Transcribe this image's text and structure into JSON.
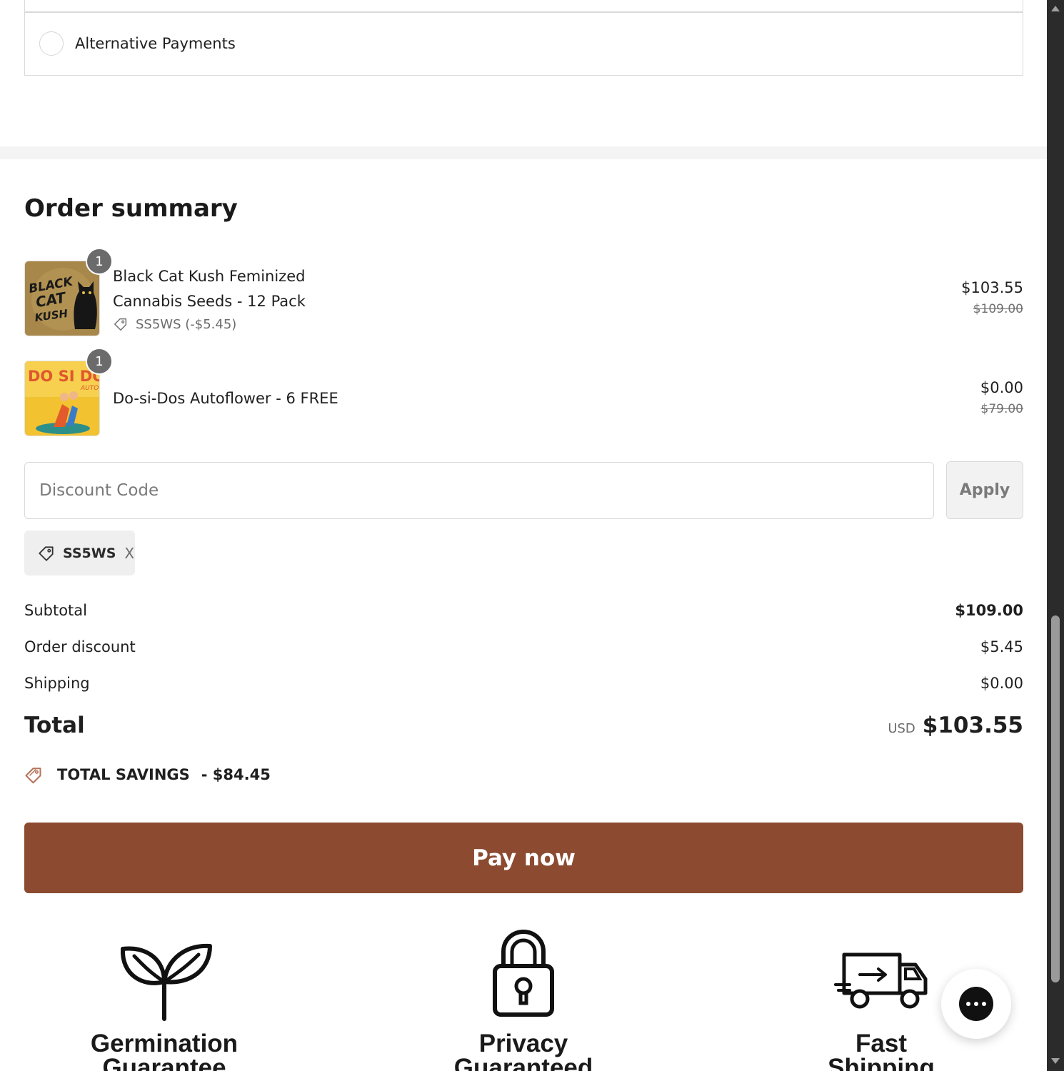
{
  "payment": {
    "option_label": "Alternative Payments"
  },
  "summary": {
    "title": "Order summary",
    "items": [
      {
        "quantity": "1",
        "name_line1": "Black Cat Kush Feminized",
        "name_line2": "Cannabis Seeds - 12 Pack",
        "discount": "SS5WS (-$5.45)",
        "price": "$103.55",
        "original_price": "$109.00",
        "image_text": [
          "BLACK",
          "CAT",
          "KUSH"
        ]
      },
      {
        "quantity": "1",
        "name": "Do-si-Dos Autoflower - 6 FREE",
        "price": "$0.00",
        "original_price": "$79.00",
        "image_text": [
          "DO SI DOS",
          "AUTO"
        ]
      }
    ],
    "discount_placeholder": "Discount Code",
    "apply_label": "Apply",
    "applied_code": "SS5WS",
    "remove_code": "X",
    "subtotal_label": "Subtotal",
    "subtotal_value": "$109.00",
    "order_discount_label": "Order discount",
    "order_discount_value": "$5.45",
    "shipping_label": "Shipping",
    "shipping_value": "$0.00",
    "total_label": "Total",
    "currency": "USD",
    "total_value": "$103.55",
    "savings_text": "TOTAL SAVINGS",
    "savings_value": "- $84.45",
    "pay_label": "Pay now"
  },
  "features": [
    {
      "title_line1": "Germination",
      "title_line2": "Guarantee",
      "icon": "sprout-icon"
    },
    {
      "title_line1": "Privacy",
      "title_line2": "Guaranteed",
      "icon": "lock-icon"
    },
    {
      "title_line1": "Fast",
      "title_line2": "Shipping",
      "icon": "truck-icon"
    }
  ],
  "colors": {
    "pay_button": "#8c4b31",
    "divider": "#f4f4f4"
  }
}
